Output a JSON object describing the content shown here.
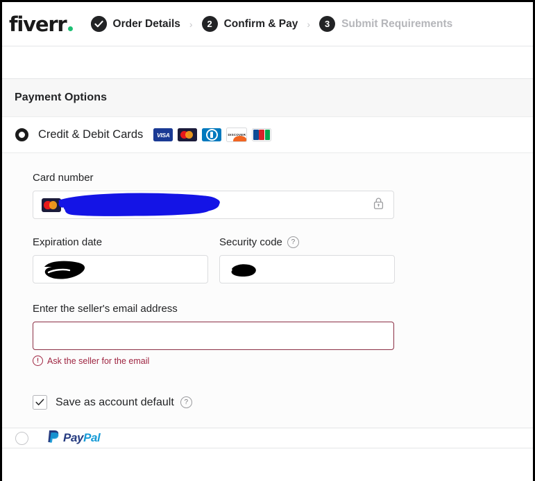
{
  "brand": {
    "logo_text": "fiverr",
    "accent_green": "#1dbf73"
  },
  "stepper": {
    "steps": [
      {
        "badge": "check",
        "label": "Order Details",
        "state": "completed"
      },
      {
        "badge": "2",
        "label": "Confirm & Pay",
        "state": "active"
      },
      {
        "badge": "3",
        "label": "Submit Requirements",
        "state": "inactive"
      }
    ],
    "separator": "›"
  },
  "panel": {
    "title": "Payment Options"
  },
  "credit_option": {
    "label": "Credit & Debit Cards",
    "selected": true,
    "brands": [
      {
        "name": "visa",
        "text": "VISA"
      },
      {
        "name": "mastercard",
        "text": ""
      },
      {
        "name": "diners-club",
        "text": ""
      },
      {
        "name": "discover",
        "text": "DISCOVER"
      },
      {
        "name": "jcb",
        "text": "JCB"
      }
    ]
  },
  "form": {
    "card_number": {
      "label": "Card number",
      "value": "",
      "placeholder": "",
      "redacted": true,
      "detected_brand": "mastercard",
      "lock_icon": "lock-icon"
    },
    "expiration": {
      "label": "Expiration date",
      "value": "",
      "placeholder": "",
      "redacted": true
    },
    "security_code": {
      "label": "Security code",
      "value": "",
      "placeholder": "",
      "redacted": true,
      "help_icon": "?"
    },
    "seller_email": {
      "label": "Enter the seller's email address",
      "value": "",
      "placeholder": "",
      "error": true,
      "error_text": "Ask the seller for the email",
      "error_color": "#9e2440"
    },
    "save_default": {
      "label": "Save as account default",
      "checked": true,
      "help_icon": "?"
    }
  },
  "paypal_option": {
    "label_part1": "Pay",
    "label_part2": "Pal",
    "selected": false
  },
  "colors": {
    "text": "#222325",
    "muted": "#b5b6ba",
    "border": "#dbdcde",
    "panel_header_bg": "#f7f7f7",
    "form_bg": "#fcfcfc",
    "redaction_black": "#000000",
    "redaction_blue": "#1414e6"
  }
}
